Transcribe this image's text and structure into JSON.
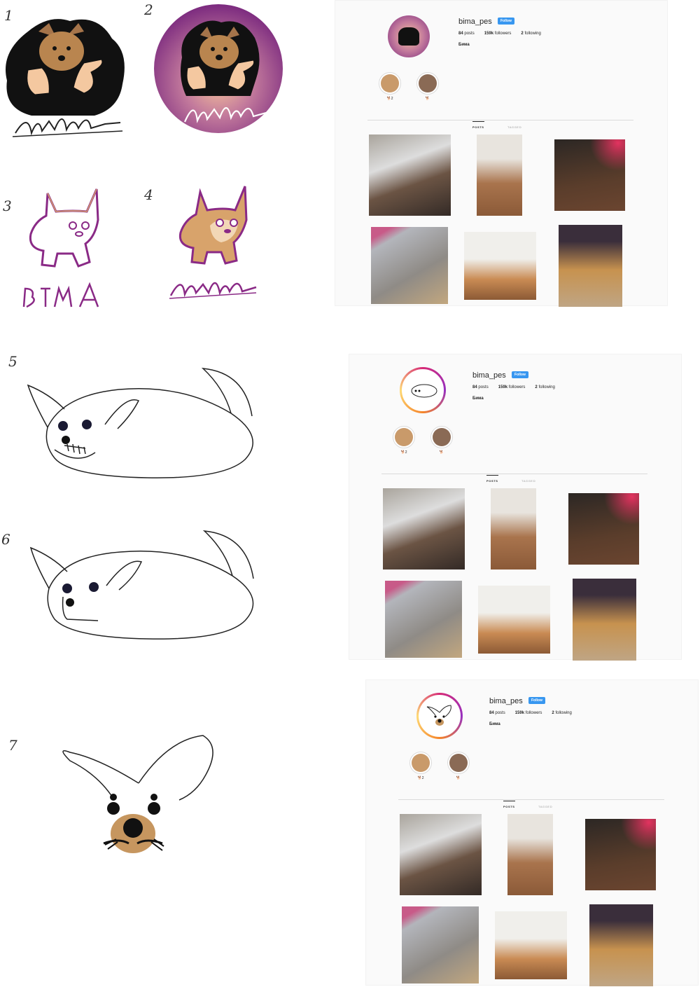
{
  "sketch_numbers": [
    "1",
    "2",
    "3",
    "4",
    "5",
    "6",
    "7"
  ],
  "wordmarks": {
    "sketch_1": "BIMA",
    "sketch_2": "BIMA",
    "sketch_3": "BIMA",
    "sketch_4": "BIMA"
  },
  "profile": {
    "username": "bima_pes",
    "follow_label": "Follow",
    "posts_count": "84",
    "posts_label": "posts",
    "followers_count": "159k",
    "followers_label": "followers",
    "following_count": "2",
    "following_label": "following",
    "bio_name": "Бима",
    "highlights": [
      {
        "label": "🐕2",
        "color": "#c99a6a"
      },
      {
        "label": "🐕",
        "color": "#8a6a55"
      }
    ],
    "tabs": {
      "posts": "POSTS",
      "tagged": "TAGGED"
    }
  },
  "colors": {
    "brand_purple": "#7b2a7f",
    "accent_blue": "#3897f0",
    "fur": "#c6965f"
  }
}
